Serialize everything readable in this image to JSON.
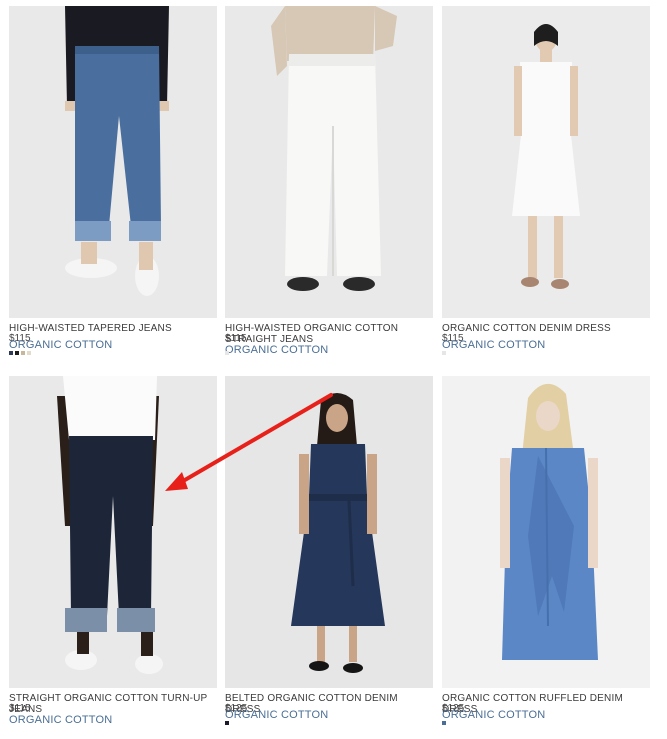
{
  "products": [
    {
      "title": "HIGH-WAISTED TAPERED JEANS",
      "price": "$115",
      "tag": "ORGANIC COTTON",
      "swatches": [
        "#2d3a55",
        "#1c1c1c",
        "#c8b89b",
        "#e3dccb"
      ]
    },
    {
      "title": "HIGH-WAISTED ORGANIC COTTON STRAIGHT JEANS",
      "price": "$115",
      "tag": "ORGANIC COTTON",
      "swatches": [
        "#e6e6e6"
      ]
    },
    {
      "title": "ORGANIC COTTON DENIM DRESS",
      "price": "$115",
      "tag": "ORGANIC COTTON",
      "swatches": [
        "#e6e6e6"
      ]
    },
    {
      "title": "STRAIGHT ORGANIC COTTON TURN-UP JEANS",
      "price": "$115",
      "tag": "ORGANIC COTTON",
      "swatches": []
    },
    {
      "title": "BELTED ORGANIC COTTON DENIM DRESS",
      "price": "$125",
      "tag": "ORGANIC COTTON",
      "swatches": [
        "#1a1a2a"
      ]
    },
    {
      "title": "ORGANIC COTTON RUFFLED DENIM DRESS",
      "price": "$125",
      "tag": "ORGANIC COTTON",
      "swatches": [
        "#4a6e95"
      ]
    }
  ],
  "colors": {
    "tag": "#4a6e95",
    "arrow": "#e8201a",
    "photo_bg": "#eaeaea"
  }
}
